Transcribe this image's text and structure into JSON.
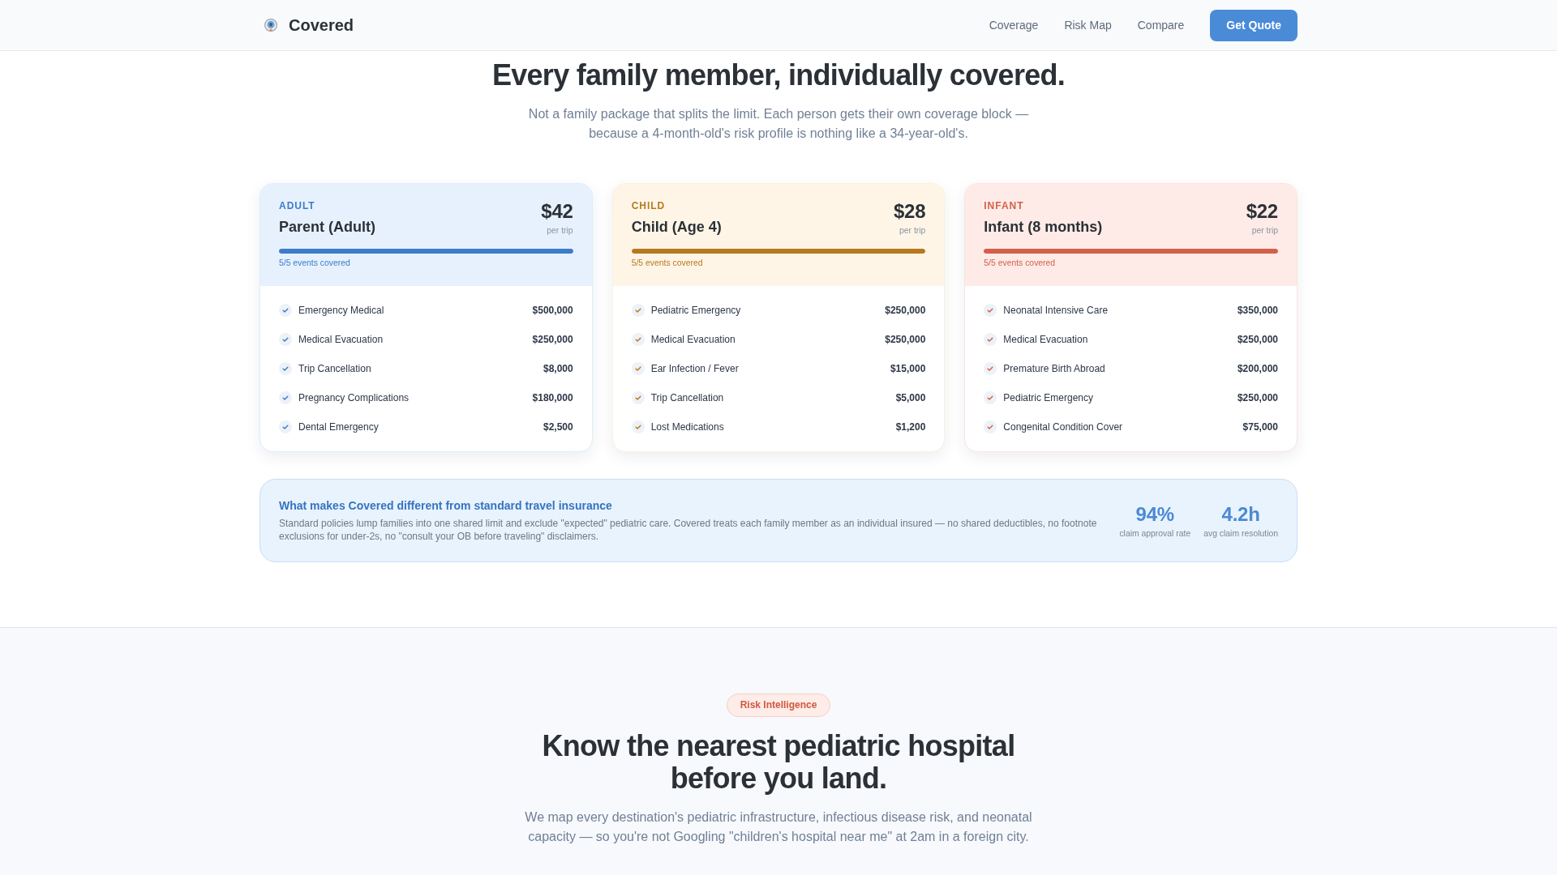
{
  "header": {
    "brand": "Covered",
    "nav": [
      {
        "label": "Coverage"
      },
      {
        "label": "Risk Map"
      },
      {
        "label": "Compare"
      }
    ],
    "cta": "Get Quote"
  },
  "hero": {
    "title": "Every family member, individually covered.",
    "subtitle": "Not a family package that splits the limit. Each person gets their own coverage block — because a 4-month-old's risk profile is nothing like a 34-year-old's."
  },
  "plans": [
    {
      "tag": "ADULT",
      "name": "Parent (Adult)",
      "price": "$42",
      "price_note": "per trip",
      "level": 1,
      "coverage_note": "5/5 events covered",
      "color": "#3d7cc9",
      "items": [
        {
          "label": "Emergency Medical",
          "amount": "$500,000"
        },
        {
          "label": "Medical Evacuation",
          "amount": "$250,000"
        },
        {
          "label": "Trip Cancellation",
          "amount": "$8,000"
        },
        {
          "label": "Pregnancy Complications",
          "amount": "$180,000"
        },
        {
          "label": "Dental Emergency",
          "amount": "$2,500"
        }
      ]
    },
    {
      "tag": "CHILD",
      "name": "Child (Age 4)",
      "price": "$28",
      "price_note": "per trip",
      "level": 1,
      "coverage_note": "5/5 events covered",
      "color": "#b7791f",
      "items": [
        {
          "label": "Pediatric Emergency",
          "amount": "$250,000"
        },
        {
          "label": "Medical Evacuation",
          "amount": "$250,000"
        },
        {
          "label": "Ear Infection / Fever",
          "amount": "$15,000"
        },
        {
          "label": "Trip Cancellation",
          "amount": "$5,000"
        },
        {
          "label": "Lost Medications",
          "amount": "$1,200"
        }
      ]
    },
    {
      "tag": "INFANT",
      "name": "Infant (8 months)",
      "price": "$22",
      "price_note": "per trip",
      "level": 1,
      "coverage_note": "5/5 events covered",
      "color": "#d2604a",
      "items": [
        {
          "label": "Neonatal Intensive Care",
          "amount": "$350,000"
        },
        {
          "label": "Medical Evacuation",
          "amount": "$250,000"
        },
        {
          "label": "Premature Birth Abroad",
          "amount": "$200,000"
        },
        {
          "label": "Pediatric Emergency",
          "amount": "$250,000"
        },
        {
          "label": "Congenital Condition Cover",
          "amount": "$75,000"
        }
      ]
    }
  ],
  "banner": {
    "title": "What makes Covered different from standard travel insurance",
    "body": "Standard policies lump families into one shared limit and exclude \"expected\" pediatric care. Covered treats each family member as an individual insured — no shared deductibles, no footnote exclusions for under-2s, no \"consult your OB before traveling\" disclaimers.",
    "stats": [
      {
        "value": "94%",
        "label": "claim approval rate"
      },
      {
        "value": "4.2h",
        "label": "avg claim resolution"
      }
    ]
  },
  "risk": {
    "badge": "Risk Intelligence",
    "title": "Know the nearest pediatric hospital before you land.",
    "subtitle": "We map every destination's pediatric infrastructure, infectious disease risk, and neonatal capacity — so you're not Googling \"children's hospital near me\" at 2am in a foreign city."
  }
}
